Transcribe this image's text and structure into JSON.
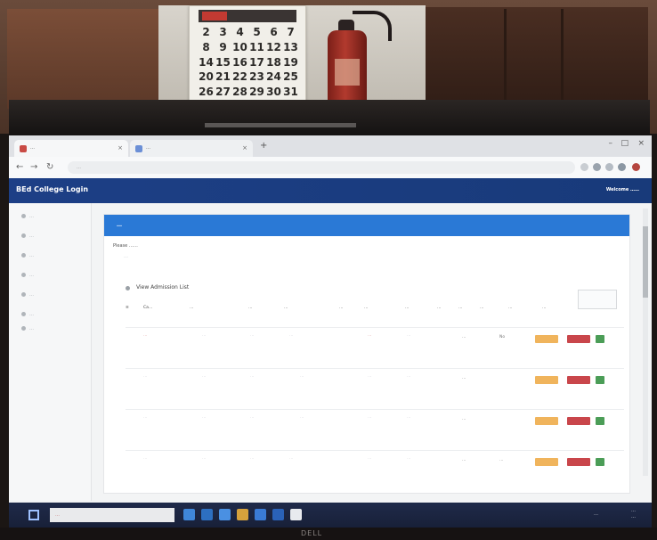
{
  "calendar": {
    "days": [
      "2",
      "3",
      "4",
      "5",
      "6",
      "7",
      "8",
      "9",
      "10",
      "11",
      "12",
      "13",
      "14",
      "15",
      "16",
      "17",
      "18",
      "19",
      "20",
      "21",
      "22",
      "23",
      "24",
      "25",
      "26",
      "27",
      "28",
      "29",
      "30",
      "31"
    ]
  },
  "browser": {
    "tabs": [
      {
        "label": "…"
      },
      {
        "label": "…"
      }
    ],
    "new_tab_icon": "+",
    "url": "…",
    "window_controls": [
      "–",
      "□",
      "×"
    ]
  },
  "app": {
    "brand": "BEd College Login",
    "welcome": "Welcome ……"
  },
  "sidebar": {
    "items": [
      "…",
      "…",
      "…",
      "…",
      "…",
      "…",
      "…"
    ]
  },
  "panel": {
    "title": "…",
    "note": "Please ……",
    "view_title": "View Admission List",
    "columns": [
      "Ca…",
      "…",
      "…",
      "…",
      "…",
      "…",
      "…",
      "…",
      "…",
      "…",
      "…",
      "…"
    ],
    "rows": [
      {
        "status": "…",
        "second": "No"
      },
      {
        "status": "…",
        "second": ""
      },
      {
        "status": "…",
        "second": ""
      },
      {
        "status": "…",
        "second": "…"
      }
    ]
  },
  "taskbar": {
    "search_placeholder": "…",
    "tray": "…",
    "clock_time": "…",
    "clock_date": "…"
  },
  "monitor": {
    "brand": "DELL"
  },
  "colors": {
    "app_header": "#1d3f86",
    "panel_header": "#2a79d6",
    "btn_amber": "#f0b45c",
    "btn_red": "#c9464b",
    "btn_green": "#4b9d57"
  }
}
